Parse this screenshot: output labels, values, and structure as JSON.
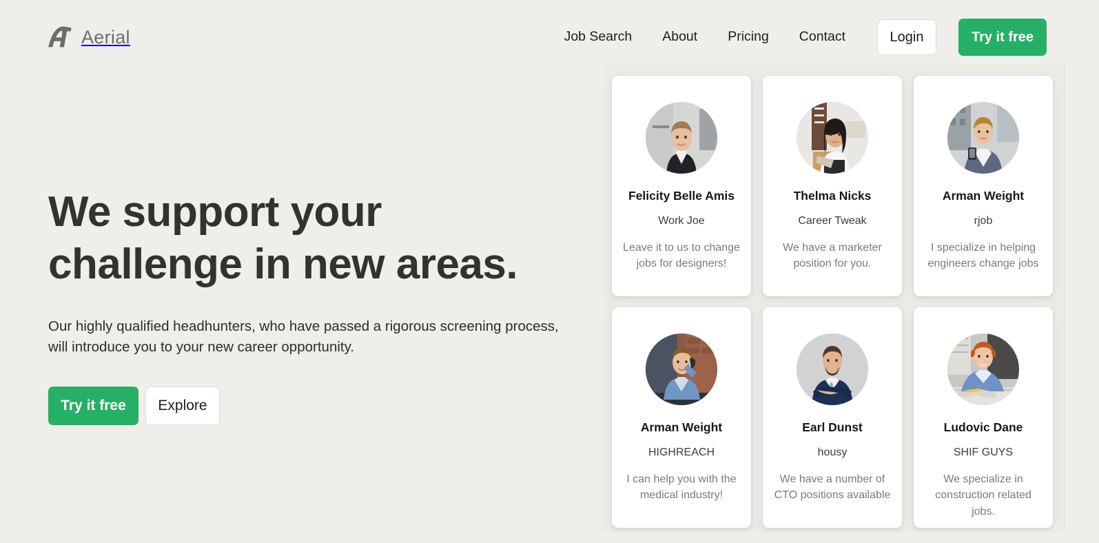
{
  "theme": {
    "page_background": "#efeeea",
    "accent_green": "#25b066",
    "card_background": "#ffffff",
    "text_primary": "#2f2f2d",
    "text_muted": "#7b7b78",
    "logo_gray": "#6e6e69"
  },
  "header": {
    "brand": {
      "logo_icon": "aerial-a-logo-icon",
      "name": "Aerial"
    },
    "nav_links": [
      {
        "label": "Job Search"
      },
      {
        "label": "About"
      },
      {
        "label": "Pricing"
      },
      {
        "label": "Contact"
      }
    ],
    "login_label": "Login",
    "try_free_label": "Try it free"
  },
  "hero": {
    "title_line1": "We support your",
    "title_line2": "challenge in new areas.",
    "subtitle": "Our highly qualified headhunters, who have passed a rigorous screening process, will introduce you to your new career opportunity.",
    "primary_cta": "Try it free",
    "secondary_cta": "Explore"
  },
  "recruiters": [
    {
      "name": "Felicity Belle Amis",
      "company": "Work Joe",
      "blurb": "Leave it to us to change jobs for designers!",
      "avatar_icon": "avatar-photo-felicity-belle-amis"
    },
    {
      "name": "Thelma Nicks",
      "company": "Career Tweak",
      "blurb": "We have a marketer position for you.",
      "avatar_icon": "avatar-photo-thelma-nicks"
    },
    {
      "name": "Arman Weight",
      "company": "rjob",
      "blurb": "I specialize in helping engineers change jobs",
      "avatar_icon": "avatar-photo-arman-weight-rjob"
    },
    {
      "name": "Arman Weight",
      "company": "HIGHREACH",
      "blurb": "I can help you with the medical industry!",
      "avatar_icon": "avatar-photo-arman-weight-highreach"
    },
    {
      "name": "Earl Dunst",
      "company": "housy",
      "blurb": "We have a number of CTO positions available",
      "avatar_icon": "avatar-photo-earl-dunst"
    },
    {
      "name": "Ludovic Dane",
      "company": "SHIF GUYS",
      "blurb": "We specialize in construction related jobs.",
      "avatar_icon": "avatar-photo-ludovic-dane"
    }
  ]
}
